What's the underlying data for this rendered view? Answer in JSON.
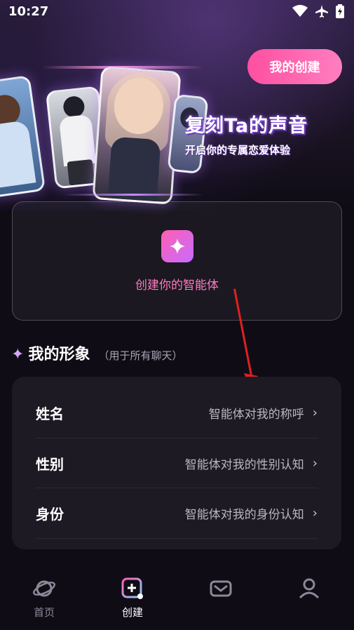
{
  "status_bar": {
    "time": "10:27",
    "icons": [
      "wifi-icon",
      "airplane-icon",
      "battery-charging-icon"
    ]
  },
  "header": {
    "create_button": "我的创建"
  },
  "hero": {
    "title": "复刻Ta的声音",
    "subtitle": "开启你的专属恋爱体验"
  },
  "create_agent": {
    "label": "创建你的智能体",
    "icon": "sparkle-icon"
  },
  "my_profile": {
    "title": "我的形象",
    "note": "（用于所有聊天）",
    "rows": [
      {
        "label": "姓名",
        "value": "智能体对我的称呼"
      },
      {
        "label": "性别",
        "value": "智能体对我的性别认知"
      },
      {
        "label": "身份",
        "value": "智能体对我的身份认知"
      }
    ]
  },
  "tabbar": {
    "tabs": [
      {
        "label": "首页",
        "icon": "planet-icon"
      },
      {
        "label": "创建",
        "icon": "add-square-icon"
      },
      {
        "label": "",
        "icon": "message-icon"
      },
      {
        "label": "",
        "icon": "user-icon"
      }
    ]
  },
  "colors": {
    "accent": "#ff5fa8",
    "background": "#0f0c16",
    "card": "#1d1a24"
  }
}
